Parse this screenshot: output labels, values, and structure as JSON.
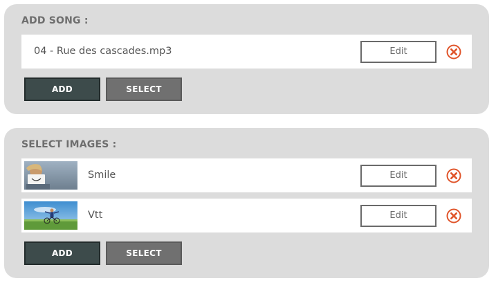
{
  "song_section": {
    "title": "ADD SONG :",
    "items": [
      {
        "label": "04 - Rue des cascades.mp3",
        "edit_label": "Edit"
      }
    ],
    "add_label": "ADD",
    "select_label": "SELECT"
  },
  "images_section": {
    "title": "SELECT IMAGES :",
    "items": [
      {
        "label": "Smile",
        "edit_label": "Edit"
      },
      {
        "label": "Vtt",
        "edit_label": "Edit"
      }
    ],
    "add_label": "ADD",
    "select_label": "SELECT"
  },
  "colors": {
    "panel_bg": "#dcdcdc",
    "add_button": "#3d4b4b",
    "select_button": "#707070",
    "remove_icon": "#e0542a"
  }
}
